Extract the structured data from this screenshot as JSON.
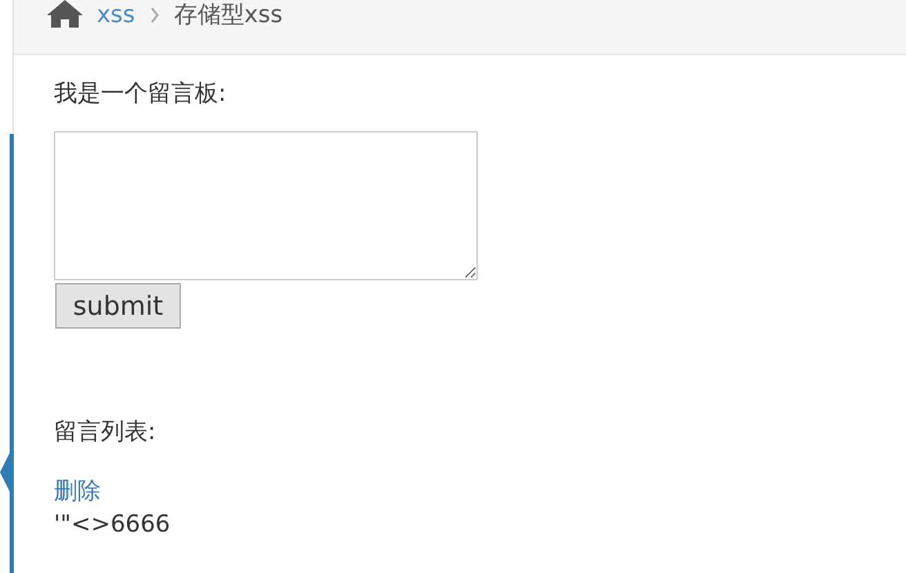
{
  "breadcrumb": [
    {
      "label": "xss",
      "link": true
    },
    {
      "label": "存储型xss",
      "link": false
    }
  ],
  "form": {
    "label": "我是一个留言板:",
    "submit": "submit"
  },
  "messages": {
    "label": "留言列表:",
    "items": [
      {
        "delete": "删除",
        "text": "'\"<>6666"
      }
    ]
  }
}
